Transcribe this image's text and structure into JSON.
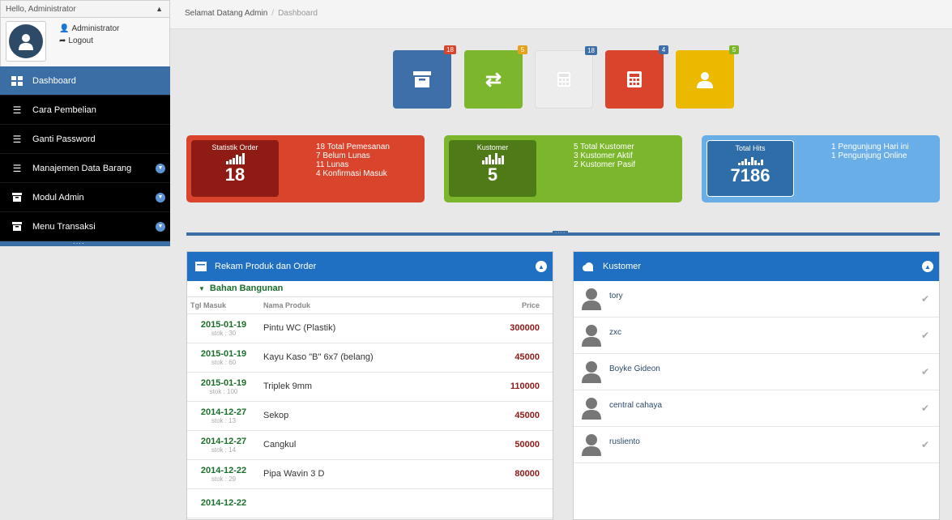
{
  "sidebar": {
    "greeting": "Hello, Administrator",
    "user_name": "Administrator",
    "logout": "Logout",
    "items": [
      {
        "label": "Dashboard",
        "icon": "dashboard-icon",
        "active": true,
        "expandable": false
      },
      {
        "label": "Cara Pembelian",
        "icon": "list-icon",
        "active": false,
        "expandable": false
      },
      {
        "label": "Ganti Password",
        "icon": "list-icon",
        "active": false,
        "expandable": false
      },
      {
        "label": "Manajemen Data Barang",
        "icon": "list-icon",
        "active": false,
        "expandable": true
      },
      {
        "label": "Modul Admin",
        "icon": "archive-icon",
        "active": false,
        "expandable": true
      },
      {
        "label": "Menu Transaksi",
        "icon": "archive-icon",
        "active": false,
        "expandable": true
      }
    ]
  },
  "breadcrumb": {
    "home": "Selamat Datang Admin",
    "current": "Dashboard"
  },
  "tiles": [
    {
      "icon": "archive-icon",
      "badge": "18",
      "color": "#3e6fa8",
      "badge_color": "#d9442c"
    },
    {
      "icon": "refresh-icon",
      "badge": "5",
      "color": "#7bb62c",
      "badge_color": "#e6a319"
    },
    {
      "icon": "calculator-icon",
      "badge": "18",
      "color": "#ededed",
      "badge_color": "#3e6fa8"
    },
    {
      "icon": "calculator-icon",
      "badge": "4",
      "color": "#d9442c",
      "badge_color": "#3e6fa8"
    },
    {
      "icon": "user-icon",
      "badge": "5",
      "color": "#eab900",
      "badge_color": "#7bb62c"
    }
  ],
  "stats": [
    {
      "label": "Statistik Order",
      "value": "18",
      "details": [
        "18 Total Pemesanan",
        "7 Belum Lunas",
        "11 Lunas",
        "4 Konfirmasi Masuk"
      ],
      "outer_color": "#d9442c",
      "inner_color": "#8f1c14"
    },
    {
      "label": "Kustomer",
      "value": "5",
      "details": [
        "5 Total Kustomer",
        "3 Kustomer Aktif",
        "2 Kustomer Pasif"
      ],
      "outer_color": "#7bb62c",
      "inner_color": "#4e7a17"
    },
    {
      "label": "Total Hits",
      "value": "7186",
      "details": [
        "1 Pengunjung Hari ini",
        "1 Pengunjung Online"
      ],
      "outer_color": "#6aaee8",
      "inner_color": "#2e6da8"
    }
  ],
  "product_panel": {
    "title": "Rekam Produk dan Order",
    "category": "Bahan Bangunan",
    "columns": [
      "Tgl Masuk",
      "Nama Produk",
      "Price"
    ],
    "rows": [
      {
        "date": "2015-01-19",
        "stock": "stok : 30",
        "name": "Pintu WC (Plastik)",
        "price": "300000"
      },
      {
        "date": "2015-01-19",
        "stock": "stok : 60",
        "name": "Kayu Kaso \"B\" 6x7 (belang)",
        "price": "45000"
      },
      {
        "date": "2015-01-19",
        "stock": "stok : 100",
        "name": "Triplek 9mm",
        "price": "110000"
      },
      {
        "date": "2014-12-27",
        "stock": "stok : 13",
        "name": "Sekop",
        "price": "45000"
      },
      {
        "date": "2014-12-27",
        "stock": "stok : 14",
        "name": "Cangkul",
        "price": "50000"
      },
      {
        "date": "2014-12-22",
        "stock": "stok : 29",
        "name": "Pipa Wavin 3 D",
        "price": "80000"
      },
      {
        "date": "2014-12-22",
        "stock": "",
        "name": "",
        "price": ""
      }
    ]
  },
  "customer_panel": {
    "title": "Kustomer",
    "customers": [
      "tory",
      "zxc",
      "Boyke Gideon",
      "central cahaya",
      "rusliento"
    ]
  }
}
